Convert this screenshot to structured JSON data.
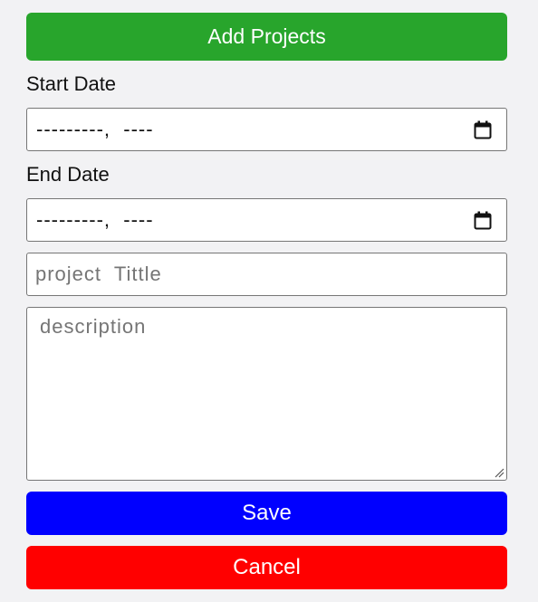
{
  "form": {
    "add_button_label": "Add Projects",
    "start_date_label": "Start Date",
    "start_date_value": "---------,  ----",
    "end_date_label": "End Date",
    "end_date_value": "---------,  ----",
    "title_placeholder": "project  Tittle",
    "description_placeholder": "description",
    "save_label": "Save",
    "cancel_label": "Cancel"
  },
  "icons": {
    "date_picker": "calendar-icon",
    "textarea_resize": "resize-handle-icon"
  },
  "colors": {
    "add_button": "#28a52c",
    "save_button": "#0000ff",
    "cancel_button": "#ff0000",
    "background": "#f2f2f4"
  }
}
